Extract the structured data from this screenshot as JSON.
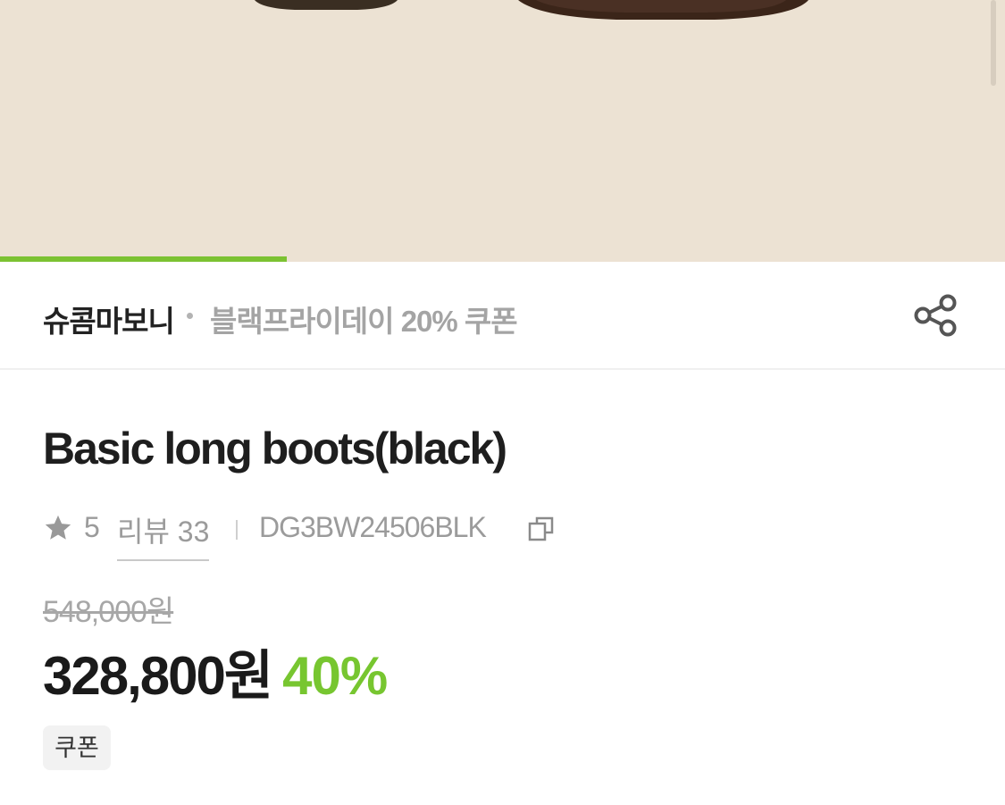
{
  "gallery": {
    "image": "product-photo-boots-bottom",
    "progress": 0.285,
    "colors": {
      "background": "#ece2d3",
      "progress": "#7cc232"
    }
  },
  "brand_row": {
    "brand": "슈콤마보니",
    "promo": "블랙프라이데이 20% 쿠폰",
    "share_icon": "share-icon"
  },
  "product": {
    "title": "Basic long boots(black)",
    "rating": "5",
    "review_label": "리뷰 33",
    "sku": "DG3BW24506BLK",
    "copy_icon": "copy-icon"
  },
  "price": {
    "original": "548,000원",
    "sale": "328,800원",
    "discount": "40%",
    "discount_color": "#77c630"
  },
  "badges": {
    "coupon": "쿠폰"
  }
}
